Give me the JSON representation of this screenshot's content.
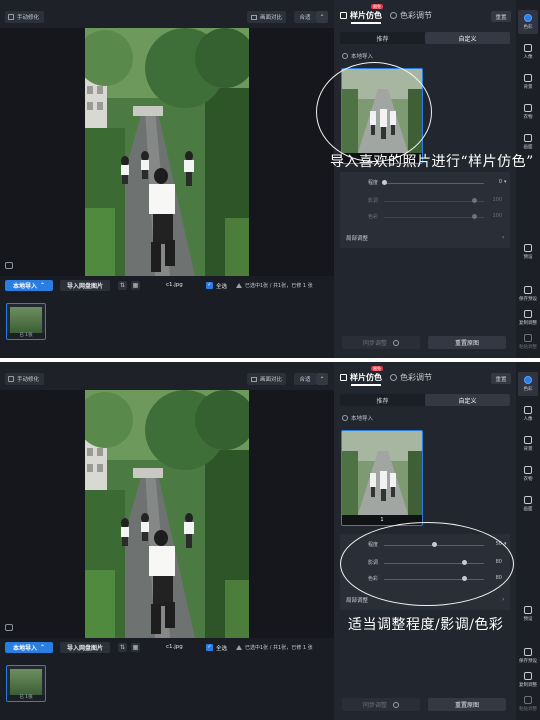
{
  "panels": [
    {
      "topbar": {
        "manual_label": "手动修化",
        "compare_label": "画面对比",
        "fit_label": "合适"
      },
      "bottombar": {
        "local_import": "本地导入",
        "cloud_import": "导入网盘图片",
        "filename": "c1.jpg",
        "select_all": "全选",
        "status": "已选中1张 / 共1张，已修 1 张",
        "thumb_caption": "已 1张"
      },
      "right": {
        "tab_sample": "样片仿色",
        "badge": "限免",
        "tab_color": "色彩调节",
        "reset": "重置",
        "seg": [
          "推荐",
          "自定义"
        ],
        "import_label": "本地导入",
        "sample_caption": "",
        "adjust": [
          {
            "label": "程度",
            "value": "0",
            "level": 0.0,
            "active": true
          },
          {
            "label": "影调",
            "value": "100",
            "level": 0.9,
            "active": false
          },
          {
            "label": "色彩",
            "value": "100",
            "level": 0.9,
            "active": false
          }
        ],
        "local_adjust": "局部调整",
        "sync": "同步调整",
        "reset_image": "重置原图"
      },
      "annotation": "导入喜欢的照片进行“样片仿色”"
    },
    {
      "topbar": {
        "manual_label": "手动修化",
        "compare_label": "画面对比",
        "fit_label": "合适"
      },
      "bottombar": {
        "local_import": "本地导入",
        "cloud_import": "导入网盘图片",
        "filename": "c1.jpg",
        "select_all": "全选",
        "status": "已选中1张 / 共1张，已修 1 张",
        "thumb_caption": "已 1张"
      },
      "right": {
        "tab_sample": "样片仿色",
        "badge": "限免",
        "tab_color": "色彩调节",
        "reset": "重置",
        "seg": [
          "推荐",
          "自定义"
        ],
        "import_label": "本地导入",
        "sample_caption": "1",
        "adjust": [
          {
            "label": "程度",
            "value": "50",
            "level": 0.5,
            "active": true
          },
          {
            "label": "影调",
            "value": "80",
            "level": 0.8,
            "active": true
          },
          {
            "label": "色彩",
            "value": "80",
            "level": 0.8,
            "active": true
          }
        ],
        "local_adjust": "局部调整",
        "sync": "同步调整",
        "reset_image": "重置原图"
      },
      "annotation": "适当调整程度/影调/色彩"
    }
  ],
  "rail": [
    {
      "label": "色彩",
      "icon": "color-icon",
      "active": true
    },
    {
      "label": "人像",
      "icon": "portrait-icon",
      "active": false
    },
    {
      "label": "背景",
      "icon": "background-icon",
      "active": false
    },
    {
      "label": "衣物",
      "icon": "clothing-icon",
      "active": false
    },
    {
      "label": "画面",
      "icon": "crop-icon",
      "active": false
    },
    {
      "label": "预设",
      "icon": "preset-icon",
      "active": false
    },
    {
      "label": "保存预设",
      "icon": "save-preset-icon",
      "active": false
    },
    {
      "label": "复制调整",
      "icon": "copy-icon",
      "active": false
    },
    {
      "label": "粘贴调整",
      "icon": "paste-icon",
      "active": false,
      "dim": true
    }
  ],
  "colors": {
    "accent": "#2a7de1",
    "panel_bg": "#22262e",
    "canvas_bg": "#15171c",
    "badge": "#e0384b"
  }
}
